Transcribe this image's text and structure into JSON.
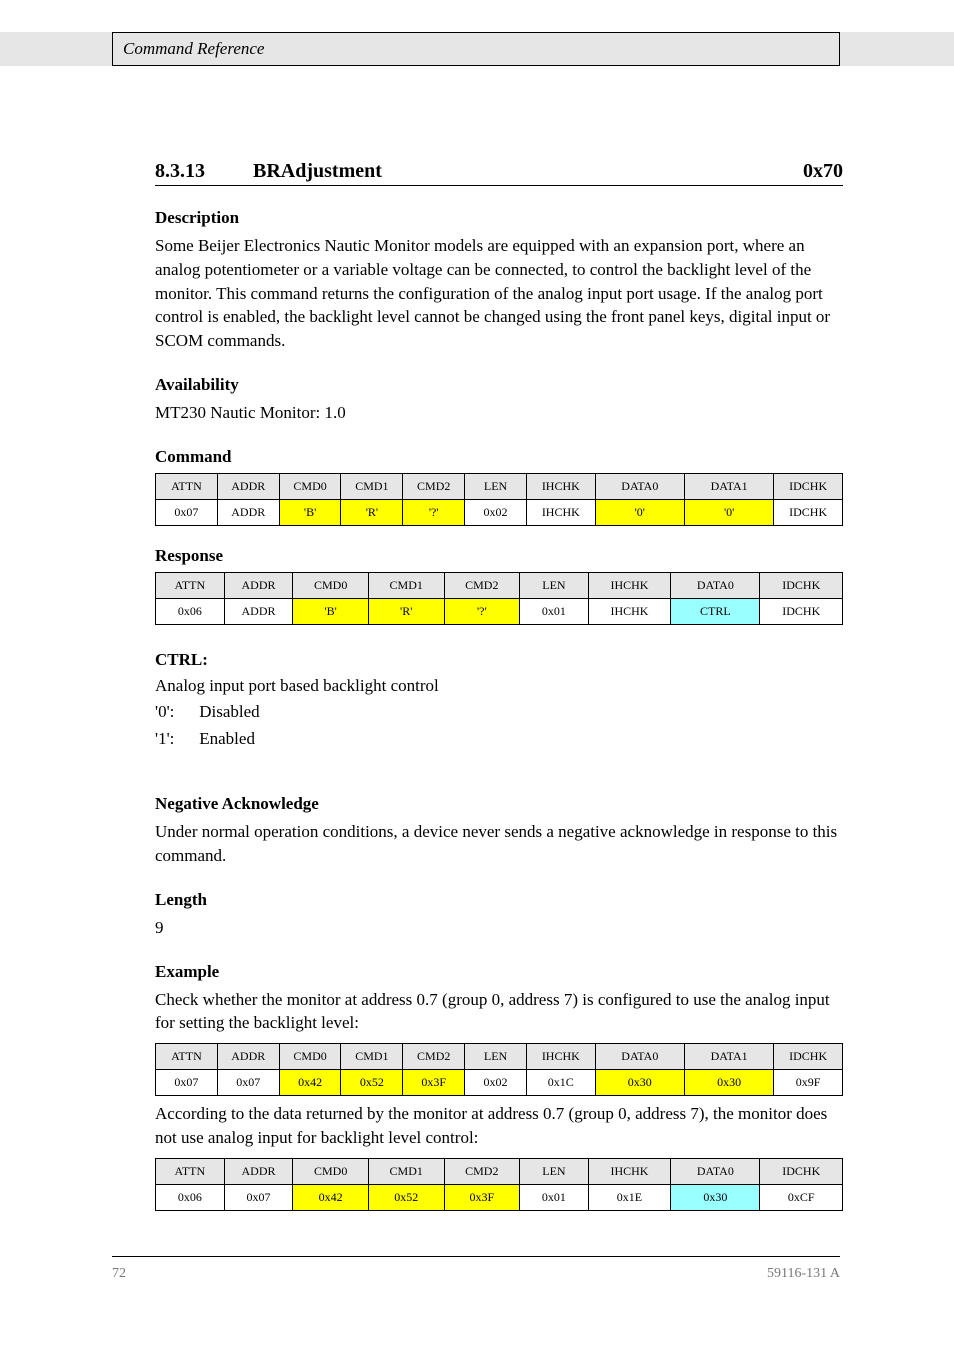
{
  "header": {
    "title": "Command Reference"
  },
  "section": {
    "num": "8.3.13",
    "name": "BRAdjustment",
    "hex": "0x70"
  },
  "desc": {
    "label": "Description",
    "text": "Some Beijer Electronics Nautic Monitor models are equipped with an expansion port, where an analog potentiometer or a variable voltage can be connected, to control the backlight level of the monitor. This command returns the configuration of the analog input port usage. If the analog port control is enabled, the backlight level cannot be changed using the front panel keys, digital input or SCOM commands."
  },
  "avail": {
    "label": "Availability",
    "text": "MT230 Nautic Monitor: 1.0"
  },
  "cmd_label": "Command",
  "response_label": "Response",
  "table1_header": [
    "ATTN",
    "ADDR",
    "CMD0",
    "CMD1",
    "CMD2",
    "LEN",
    "IHCHK",
    "DATA0",
    "DATA1",
    "IDCHK"
  ],
  "table1_row": [
    "0x07",
    "ADDR",
    "'B'",
    "'R'",
    "'?'",
    "0x02",
    "IHCHK",
    "'0'",
    "'0'",
    "IDCHK"
  ],
  "table2_header": [
    "ATTN",
    "ADDR",
    "CMD0",
    "CMD1",
    "CMD2",
    "LEN",
    "IHCHK",
    "DATA0",
    "IDCHK"
  ],
  "table2_row": [
    "0x06",
    "ADDR",
    "'B'",
    "'R'",
    "'?'",
    "0x01",
    "IHCHK",
    "CTRL",
    "IDCHK"
  ],
  "ctrl": {
    "label": "CTRL:",
    "line1": "Analog input port based backlight control",
    "line2a": "'0':",
    "line2b": "Disabled",
    "line3a": "'1':",
    "line3b": "Enabled"
  },
  "nack": {
    "label": "Negative Acknowledge",
    "text": "Under normal operation conditions, a device never sends a negative acknowledge in response to this command."
  },
  "length": {
    "label": "Length",
    "text": "9"
  },
  "example": {
    "label": "Example",
    "text1": "Check whether the monitor at address 0.7 (group 0, address 7) is configured to use the analog input for setting the backlight level:",
    "text2": "According to the data returned by the monitor at address 0.7 (group 0, address 7), the monitor does not use analog input for backlight level control:"
  },
  "table3_header": [
    "ATTN",
    "ADDR",
    "CMD0",
    "CMD1",
    "CMD2",
    "LEN",
    "IHCHK",
    "DATA0",
    "DATA1",
    "IDCHK"
  ],
  "table3_row": [
    "0x07",
    "0x07",
    "0x42",
    "0x52",
    "0x3F",
    "0x02",
    "0x1C",
    "0x30",
    "0x30",
    "0x9F"
  ],
  "table4_header": [
    "ATTN",
    "ADDR",
    "CMD0",
    "CMD1",
    "CMD2",
    "LEN",
    "IHCHK",
    "DATA0",
    "IDCHK"
  ],
  "table4_row": [
    "0x06",
    "0x07",
    "0x42",
    "0x52",
    "0x3F",
    "0x01",
    "0x1E",
    "0x30",
    "0xCF"
  ],
  "footer": {
    "page": "72",
    "doc": "59116-131 A"
  }
}
